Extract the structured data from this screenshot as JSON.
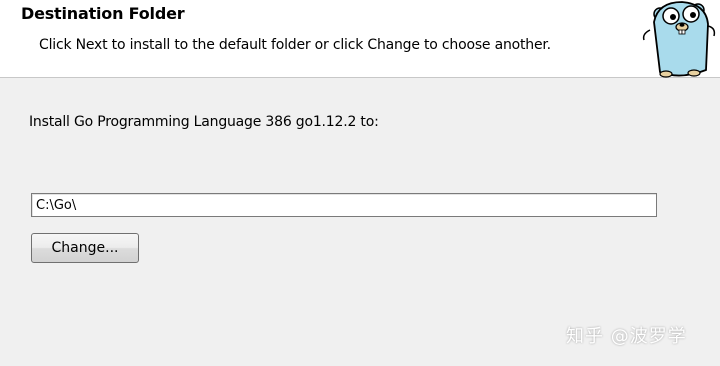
{
  "header": {
    "title": "Destination Folder",
    "subtitle": "Click Next to install to the default folder or click Change to choose another."
  },
  "body": {
    "install_label": "Install Go Programming Language 386 go1.12.2 to:",
    "install_path": "C:\\Go\\",
    "change_button_label": "Change..."
  },
  "watermark": "知乎 @波罗学",
  "icons": {
    "header_logo": "gopher-mascot-icon"
  },
  "colors": {
    "dialog_background": "#f0f0f0",
    "header_background": "#ffffff",
    "gopher_body": "#a9dbec"
  }
}
